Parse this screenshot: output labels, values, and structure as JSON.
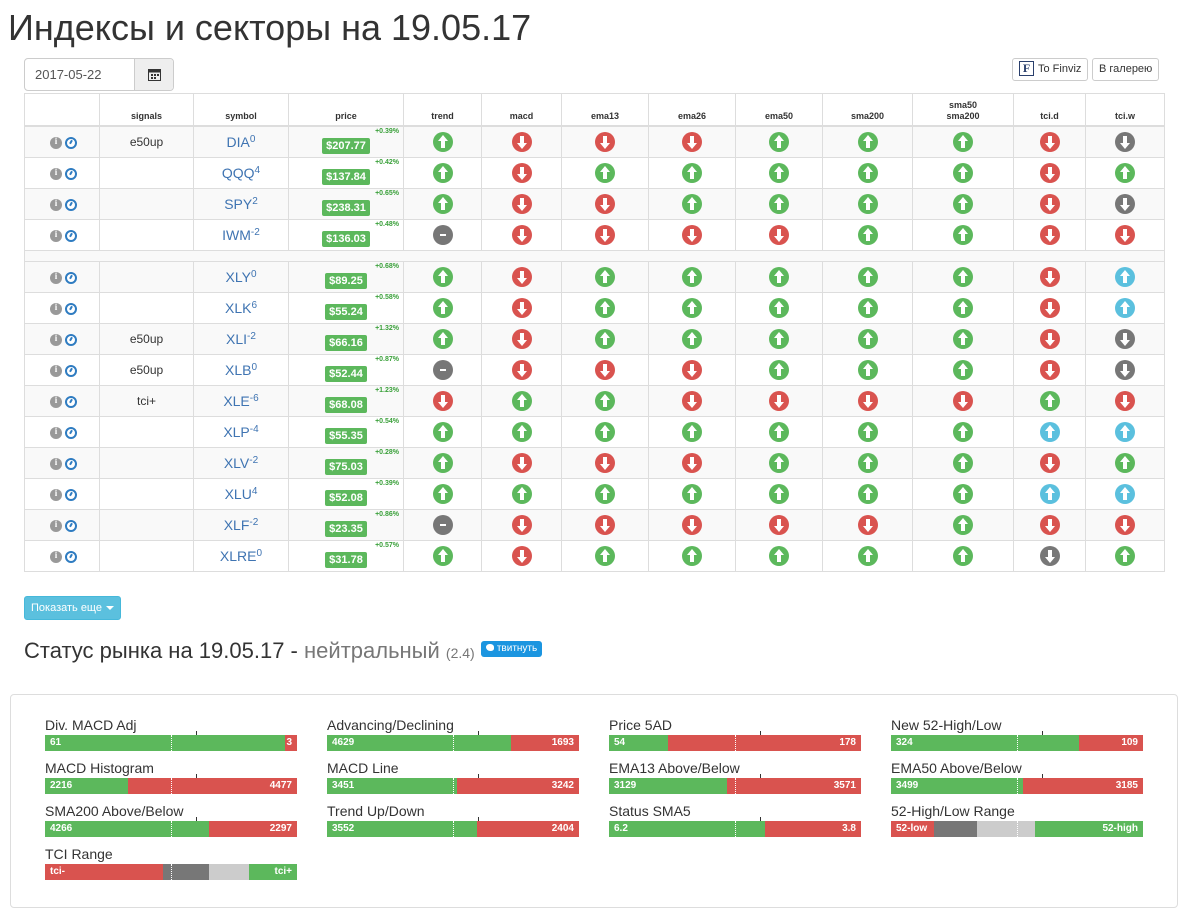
{
  "page_title": "Индексы и секторы на 19.05.17",
  "date_input": {
    "value": "2017-05-22"
  },
  "buttons": {
    "finviz": "To Finviz",
    "gallery": "В галерею",
    "show_more": "Показать еще",
    "tweet": "твитнуть"
  },
  "columns": {
    "signals": "signals",
    "symbol": "symbol",
    "price": "price",
    "trend": "trend",
    "macd": "macd",
    "ema13": "ema13",
    "ema26": "ema26",
    "ema50": "ema50",
    "sma200": "sma200",
    "sma50_sma200_a": "sma50",
    "sma50_sma200_b": "sma200",
    "tci_d": "tci.d",
    "tci_w": "tci.w"
  },
  "rows": [
    {
      "signal": "e50up",
      "symbol": "DIA",
      "sup": "0",
      "price": "$207.77",
      "change": "+0.39%",
      "ind": [
        "g-up",
        "r-down",
        "r-down",
        "r-down",
        "g-up",
        "g-up",
        "g-up",
        "r-down",
        "d-down"
      ]
    },
    {
      "signal": "",
      "symbol": "QQQ",
      "sup": "4",
      "price": "$137.84",
      "change": "+0.42%",
      "ind": [
        "g-up",
        "r-down",
        "g-up",
        "g-up",
        "g-up",
        "g-up",
        "g-up",
        "r-down",
        "g-up"
      ]
    },
    {
      "signal": "",
      "symbol": "SPY",
      "sup": "2",
      "price": "$238.31",
      "change": "+0.65%",
      "ind": [
        "g-up",
        "r-down",
        "r-down",
        "g-up",
        "g-up",
        "g-up",
        "g-up",
        "r-down",
        "d-down"
      ]
    },
    {
      "signal": "",
      "symbol": "IWM",
      "sup": "-2",
      "price": "$136.03",
      "change": "+0.48%",
      "ind": [
        "d-dash",
        "r-down",
        "r-down",
        "r-down",
        "r-down",
        "g-up",
        "g-up",
        "r-down",
        "r-down"
      ]
    },
    {
      "separator": true
    },
    {
      "signal": "",
      "symbol": "XLY",
      "sup": "0",
      "price": "$89.25",
      "change": "+0.68%",
      "ind": [
        "g-up",
        "r-down",
        "g-up",
        "g-up",
        "g-up",
        "g-up",
        "g-up",
        "r-down",
        "c-up"
      ]
    },
    {
      "signal": "",
      "symbol": "XLK",
      "sup": "6",
      "price": "$55.24",
      "change": "+0.58%",
      "ind": [
        "g-up",
        "r-down",
        "g-up",
        "g-up",
        "g-up",
        "g-up",
        "g-up",
        "r-down",
        "c-up"
      ]
    },
    {
      "signal": "e50up",
      "symbol": "XLI",
      "sup": "-2",
      "price": "$66.16",
      "change": "+1.32%",
      "ind": [
        "g-up",
        "r-down",
        "g-up",
        "g-up",
        "g-up",
        "g-up",
        "g-up",
        "r-down",
        "d-down"
      ]
    },
    {
      "signal": "e50up",
      "symbol": "XLB",
      "sup": "0",
      "price": "$52.44",
      "change": "+0.87%",
      "ind": [
        "d-dash",
        "r-down",
        "r-down",
        "r-down",
        "g-up",
        "g-up",
        "g-up",
        "r-down",
        "d-down"
      ]
    },
    {
      "signal": "tci+",
      "symbol": "XLE",
      "sup": "-6",
      "price": "$68.08",
      "change": "+1.23%",
      "ind": [
        "r-down",
        "g-up",
        "g-up",
        "r-down",
        "r-down",
        "r-down",
        "r-down",
        "g-up",
        "r-down"
      ]
    },
    {
      "signal": "",
      "symbol": "XLP",
      "sup": "-4",
      "price": "$55.35",
      "change": "+0.54%",
      "ind": [
        "g-up",
        "g-up",
        "g-up",
        "g-up",
        "g-up",
        "g-up",
        "g-up",
        "c-up",
        "c-up"
      ]
    },
    {
      "signal": "",
      "symbol": "XLV",
      "sup": "-2",
      "price": "$75.03",
      "change": "+0.28%",
      "ind": [
        "g-up",
        "r-down",
        "r-down",
        "r-down",
        "g-up",
        "g-up",
        "g-up",
        "r-down",
        "g-up"
      ]
    },
    {
      "signal": "",
      "symbol": "XLU",
      "sup": "4",
      "price": "$52.08",
      "change": "+0.39%",
      "ind": [
        "g-up",
        "g-up",
        "g-up",
        "g-up",
        "g-up",
        "g-up",
        "g-up",
        "c-up",
        "c-up"
      ]
    },
    {
      "signal": "",
      "symbol": "XLF",
      "sup": "-2",
      "price": "$23.35",
      "change": "+0.86%",
      "ind": [
        "d-dash",
        "r-down",
        "r-down",
        "r-down",
        "r-down",
        "r-down",
        "g-up",
        "r-down",
        "r-down"
      ]
    },
    {
      "signal": "",
      "symbol": "XLRE",
      "sup": "0",
      "price": "$31.78",
      "change": "+0.57%",
      "ind": [
        "g-up",
        "r-down",
        "g-up",
        "g-up",
        "g-up",
        "g-up",
        "g-up",
        "d-down",
        "g-up"
      ]
    }
  ],
  "status": {
    "label": "Статус рынка на 19.05.17 -",
    "value": "нейтральный",
    "score": "(2.4)"
  },
  "metrics": [
    {
      "label": "Div. MACD Adj",
      "left": "61",
      "right": "3",
      "share": 0.953
    },
    {
      "label": "Advancing/Declining",
      "left": "4629",
      "right": "1693",
      "share": 0.732
    },
    {
      "label": "Price 5AD",
      "left": "54",
      "right": "178",
      "share": 0.233
    },
    {
      "label": "New 52-High/Low",
      "left": "324",
      "right": "109",
      "share": 0.748
    },
    {
      "label": "MACD Histogram",
      "left": "2216",
      "right": "4477",
      "share": 0.331
    },
    {
      "label": "MACD Line",
      "left": "3451",
      "right": "3242",
      "share": 0.516
    },
    {
      "label": "EMA13 Above/Below",
      "left": "3129",
      "right": "3571",
      "share": 0.467
    },
    {
      "label": "EMA50 Above/Below",
      "left": "3499",
      "right": "3185",
      "share": 0.523
    },
    {
      "label": "SMA200 Above/Below",
      "left": "4266",
      "right": "2297",
      "share": 0.65
    },
    {
      "label": "Trend Up/Down",
      "left": "3552",
      "right": "2404",
      "share": 0.596
    },
    {
      "label": "Status SMA5",
      "left": "6.2",
      "right": "3.8",
      "share": 0.62
    },
    {
      "label": "52-High/Low Range",
      "range": true,
      "left": "52-low",
      "right": "52-high",
      "segs": [
        [
          "r",
          0.17
        ],
        [
          "d",
          0.17
        ],
        [
          "l",
          0.23
        ],
        [
          "g",
          0.43
        ]
      ]
    },
    {
      "label": "TCI Range",
      "range": true,
      "left": "tci-",
      "right": "tci+",
      "segs": [
        [
          "r",
          0.47
        ],
        [
          "d",
          0.18
        ],
        [
          "l",
          0.16
        ],
        [
          "g",
          0.19
        ]
      ]
    }
  ]
}
